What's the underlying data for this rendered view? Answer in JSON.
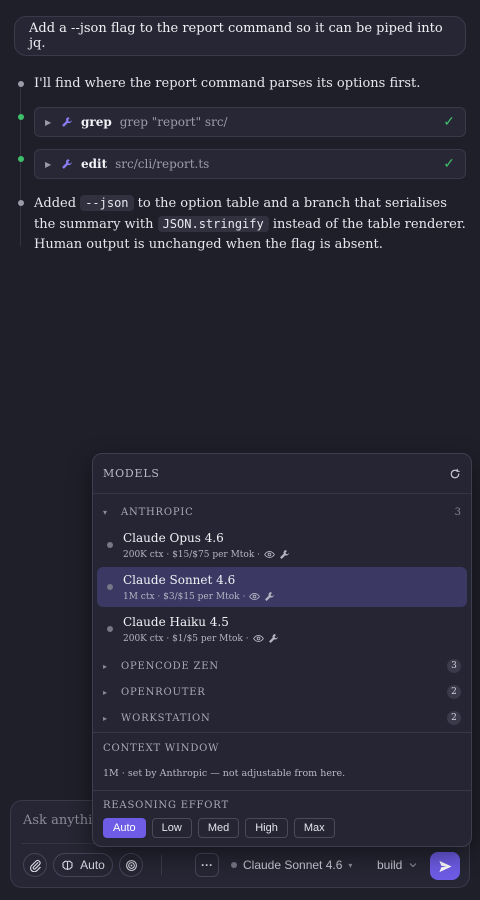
{
  "conversation": {
    "user_message": "Add a --json flag to the report command so it can be piped into jq.",
    "assistant_intro": "I'll find where the report command parses its options first.",
    "tools": [
      {
        "name": "grep",
        "args": "grep \"report\" src/",
        "status": "done"
      },
      {
        "name": "edit",
        "args": "src/cli/report.ts",
        "status": "done"
      }
    ],
    "summary": {
      "part1": "Added ",
      "code1": "--json",
      "part2": " to the option table and a branch that serialises the summary with ",
      "code2": "JSON.stringify",
      "part3": " instead of the table renderer. Human output is unchanged when the flag is absent."
    },
    "check_glyph": "✓"
  },
  "models_popup": {
    "title": "MODELS",
    "groups": [
      {
        "name": "ANTHROPIC",
        "count": "3",
        "expanded": true
      },
      {
        "name": "OPENCODE ZEN",
        "count": "3",
        "expanded": false
      },
      {
        "name": "OPENROUTER",
        "count": "2",
        "expanded": false
      },
      {
        "name": "WORKSTATION",
        "count": "2",
        "expanded": false
      }
    ],
    "models": [
      {
        "name": "Claude Opus 4.6",
        "meta": "200K ctx · $15/$75 per Mtok ·",
        "selected": false
      },
      {
        "name": "Claude Sonnet 4.6",
        "meta": "1M ctx · $3/$15 per Mtok ·",
        "selected": true
      },
      {
        "name": "Claude Haiku 4.5",
        "meta": "200K ctx · $1/$5 per Mtok ·",
        "selected": false
      }
    ],
    "context_window": {
      "title": "CONTEXT WINDOW",
      "text": "1M · set by Anthropic — not adjustable from here."
    },
    "reasoning_effort": {
      "title": "REASONING EFFORT",
      "options": [
        "Auto",
        "Low",
        "Med",
        "High",
        "Max"
      ],
      "selected": "Auto"
    }
  },
  "composer": {
    "placeholder": "Ask anything",
    "auto_label": "Auto",
    "more_label": "···",
    "model_label": "Claude Sonnet 4.6",
    "mode_label": "build"
  },
  "colors": {
    "accent": "#6e5ce6",
    "success": "#3fbf6a",
    "background": "#1f1f2a",
    "selected_row": "#3b3863"
  }
}
